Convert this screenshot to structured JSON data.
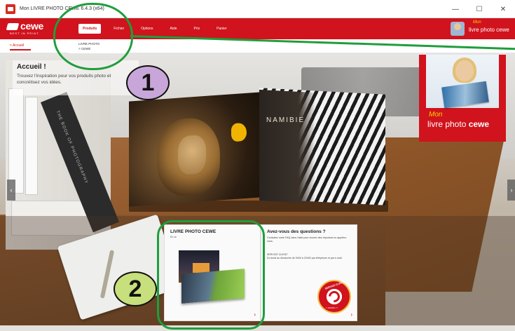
{
  "window": {
    "title": "Mon LIVRE PHOTO CEWE 6.4.3 (x64)",
    "minimize": "—",
    "maximize": "☐",
    "close": "✕"
  },
  "brand": {
    "logo": "cewe",
    "tagline": "BEST IN PRINT",
    "right_prefix": "Mon",
    "right_name": "livre photo cewe"
  },
  "nav": {
    "tabs": [
      {
        "label": "Produits",
        "active": true
      },
      {
        "label": "Fichier"
      },
      {
        "label": "Options"
      },
      {
        "label": "Aide"
      },
      {
        "label": "Prix"
      },
      {
        "label": "Panier"
      }
    ]
  },
  "dropdown": {
    "items": [
      "LIVRE PHOTO",
      "> CEWE"
    ]
  },
  "breadcrumb": "< Accueil",
  "welcome": {
    "title": "Accueil !",
    "text": "Trouvez l'inspiration pour vos produits photo et concrétisez vos idées."
  },
  "book": {
    "page_title": "NAMIBIE"
  },
  "badges": {
    "one": "1",
    "two": "2"
  },
  "card_book": {
    "title": "LIVRE PHOTO CEWE",
    "sub": "En ce",
    "arrow": "›"
  },
  "card_help": {
    "title": "Avez-vous des questions ?",
    "text": "Consultez notre FAQ dans l'aide pour trouver des réponses ou appelez-nous.",
    "service_title": "SERVICE CLIENT",
    "service_text": "Du lundi au dimanche de 9h00 à 22h00 par téléphone et par e-mail.",
    "badge_label": "SERVICE CLIENT",
    "badge_foot": "7 JOURS / 7",
    "arrow": "›"
  },
  "ad": {
    "prefix": "Mon",
    "name_plain": "livre photo ",
    "name_bold": "cewe"
  },
  "shelf_book_title": "THE BOOK OF PHOTOGRAPHY",
  "colors": {
    "brand_red": "#d0131d",
    "highlight_green": "#1f9e3c",
    "badge_one": "#c9a6d9",
    "badge_two": "#c7df7c"
  }
}
